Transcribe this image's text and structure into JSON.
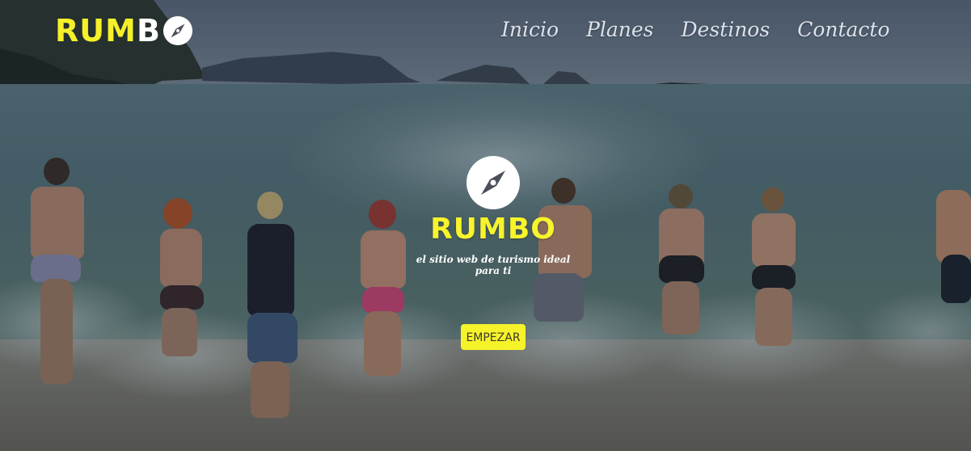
{
  "brand": {
    "name_part1": "RUM",
    "name_part2": "B",
    "icon": "compass-icon",
    "accent_color": "#f5f02a"
  },
  "nav": {
    "items": [
      {
        "label": "Inicio"
      },
      {
        "label": "Planes"
      },
      {
        "label": "Destinos"
      },
      {
        "label": "Contacto"
      }
    ]
  },
  "hero": {
    "icon": "compass-icon",
    "title": "RUMBO",
    "tagline": "el sitio web de turismo ideal para ti",
    "cta_label": "EMPEZAR",
    "background": "beach-people-running-into-sea"
  }
}
